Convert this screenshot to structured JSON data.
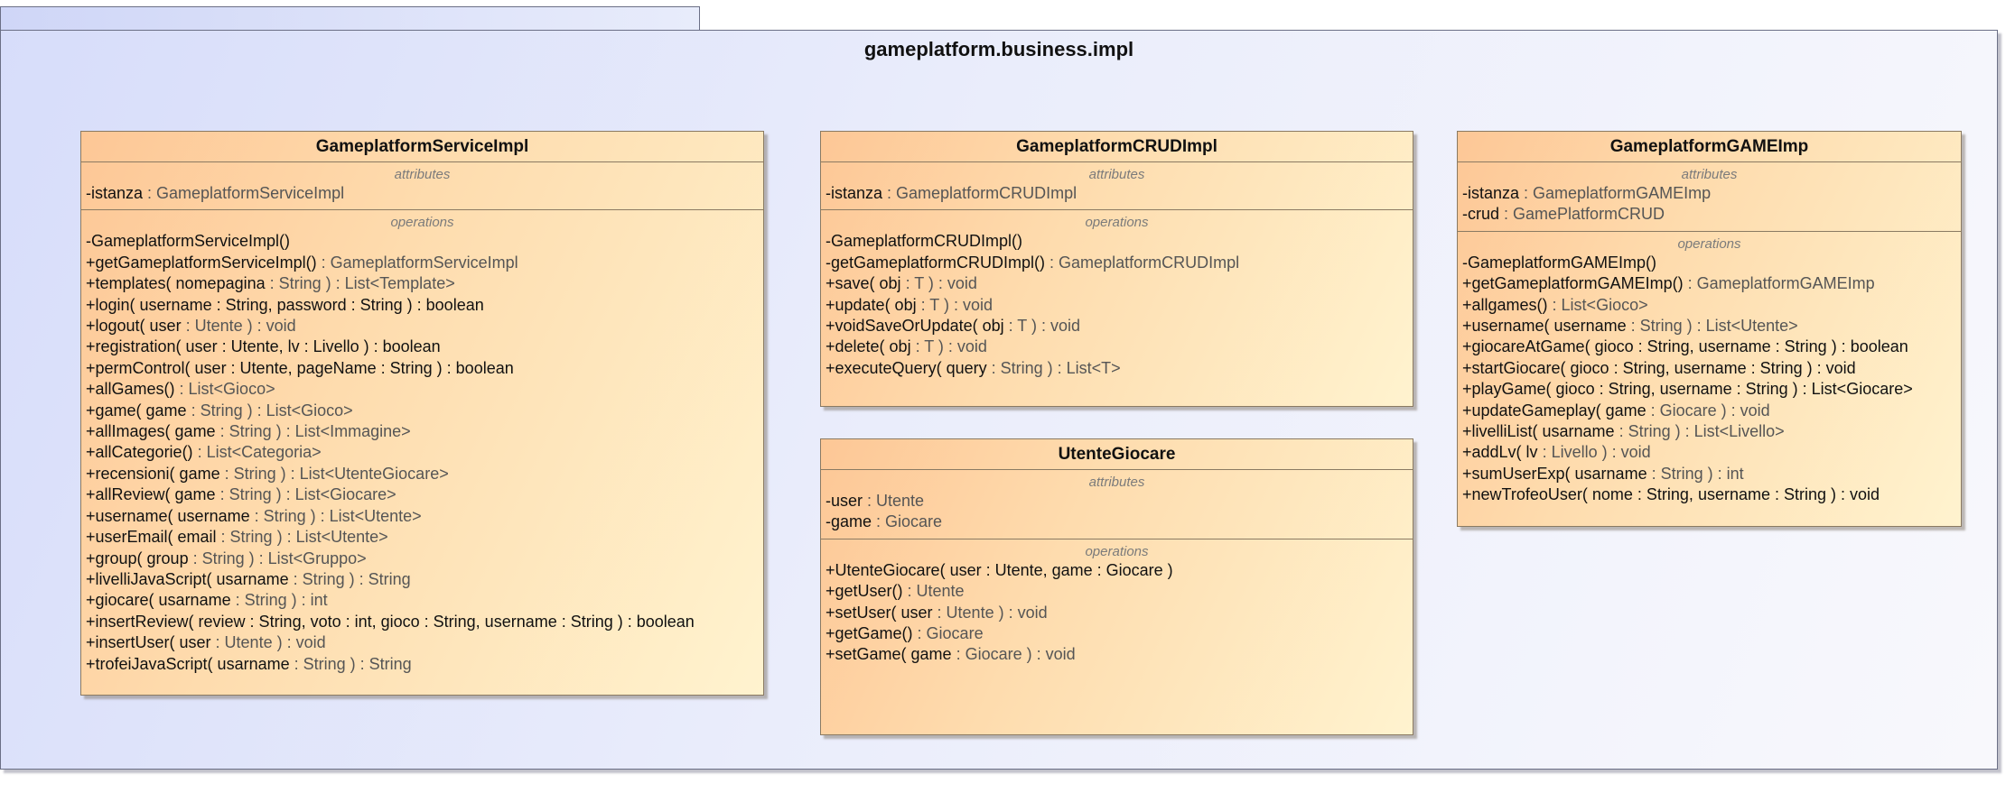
{
  "package": {
    "name": "gameplatform.business.impl"
  },
  "labels": {
    "attributes": "attributes",
    "operations": "operations"
  },
  "classes": {
    "service": {
      "name": "GameplatformServiceImpl",
      "attributes": [
        {
          "sig": "-istanza",
          "type": " : GameplatformServiceImpl"
        }
      ],
      "operations": [
        {
          "sig": "-GameplatformServiceImpl()",
          "type": ""
        },
        {
          "sig": "+getGameplatformServiceImpl()",
          "type": " : GameplatformServiceImpl"
        },
        {
          "sig": "+templates( nomepagina",
          "type": " : String ) : List<Template>"
        },
        {
          "sig": "+login( username : String, password : String ) : boolean",
          "type": ""
        },
        {
          "sig": "+logout( user",
          "type": " : Utente ) : void"
        },
        {
          "sig": "+registration( user : Utente, lv : Livello ) : boolean",
          "type": ""
        },
        {
          "sig": "+permControl( user : Utente, pageName : String ) : boolean",
          "type": ""
        },
        {
          "sig": "+allGames()",
          "type": " : List<Gioco>"
        },
        {
          "sig": "+game( game",
          "type": " : String ) : List<Gioco>"
        },
        {
          "sig": "+allImages( game",
          "type": " : String ) : List<Immagine>"
        },
        {
          "sig": "+allCategorie()",
          "type": " : List<Categoria>"
        },
        {
          "sig": "+recensioni( game",
          "type": " : String ) : List<UtenteGiocare>"
        },
        {
          "sig": "+allReview( game",
          "type": " : String ) : List<Giocare>"
        },
        {
          "sig": "+username( username",
          "type": " : String ) : List<Utente>"
        },
        {
          "sig": "+userEmail( email",
          "type": " : String ) : List<Utente>"
        },
        {
          "sig": "+group( group",
          "type": " : String ) : List<Gruppo>"
        },
        {
          "sig": "+livelliJavaScript( usarname",
          "type": " : String ) : String"
        },
        {
          "sig": "+giocare( usarname",
          "type": " : String ) : int"
        },
        {
          "sig": "+insertReview( review : String, voto : int, gioco : String, username : String ) : boolean",
          "type": ""
        },
        {
          "sig": "+insertUser( user",
          "type": " : Utente ) : void"
        },
        {
          "sig": "+trofeiJavaScript( usarname",
          "type": " : String ) : String"
        }
      ]
    },
    "crud": {
      "name": "GameplatformCRUDImpl",
      "attributes": [
        {
          "sig": "-istanza",
          "type": " : GameplatformCRUDImpl"
        }
      ],
      "operations": [
        {
          "sig": "-GameplatformCRUDImpl()",
          "type": ""
        },
        {
          "sig": "-getGameplatformCRUDImpl()",
          "type": " : GameplatformCRUDImpl"
        },
        {
          "sig": "+save( obj",
          "type": " : T ) : void"
        },
        {
          "sig": "+update( obj",
          "type": " : T ) : void"
        },
        {
          "sig": "+voidSaveOrUpdate( obj",
          "type": " : T ) : void"
        },
        {
          "sig": "+delete( obj",
          "type": " : T ) : void"
        },
        {
          "sig": "+executeQuery( query",
          "type": " : String ) : List<T>"
        }
      ]
    },
    "utente": {
      "name": "UtenteGiocare",
      "attributes": [
        {
          "sig": "-user",
          "type": " : Utente"
        },
        {
          "sig": "-game",
          "type": " : Giocare"
        }
      ],
      "operations": [
        {
          "sig": "+UtenteGiocare( user : Utente, game : Giocare )",
          "type": ""
        },
        {
          "sig": "+getUser()",
          "type": " : Utente"
        },
        {
          "sig": "+setUser( user",
          "type": " : Utente ) : void"
        },
        {
          "sig": "+getGame()",
          "type": " : Giocare"
        },
        {
          "sig": "+setGame( game",
          "type": " : Giocare ) : void"
        }
      ]
    },
    "game": {
      "name": "GameplatformGAMEImp",
      "attributes": [
        {
          "sig": "-istanza",
          "type": " : GameplatformGAMEImp"
        },
        {
          "sig": "-crud",
          "type": " : GamePlatformCRUD"
        }
      ],
      "operations": [
        {
          "sig": "-GameplatformGAMEImp()",
          "type": ""
        },
        {
          "sig": "+getGameplatformGAMEImp()",
          "type": " : GameplatformGAMEImp"
        },
        {
          "sig": "+allgames()",
          "type": " : List<Gioco>"
        },
        {
          "sig": "+username( username",
          "type": " : String ) : List<Utente>"
        },
        {
          "sig": "+giocareAtGame( gioco : String, username : String ) : boolean",
          "type": ""
        },
        {
          "sig": "+startGiocare( gioco : String, username : String ) : void",
          "type": ""
        },
        {
          "sig": "+playGame( gioco : String, username : String ) : List<Giocare>",
          "type": ""
        },
        {
          "sig": "+updateGameplay( game",
          "type": " : Giocare ) : void"
        },
        {
          "sig": "+livelliList( usarname",
          "type": " : String ) : List<Livello>"
        },
        {
          "sig": "+addLv( lv",
          "type": " : Livello ) : void"
        },
        {
          "sig": "+sumUserExp( usarname",
          "type": " : String ) : int"
        },
        {
          "sig": "+newTrofeoUser( nome : String, username : String ) : void",
          "type": ""
        }
      ]
    }
  }
}
